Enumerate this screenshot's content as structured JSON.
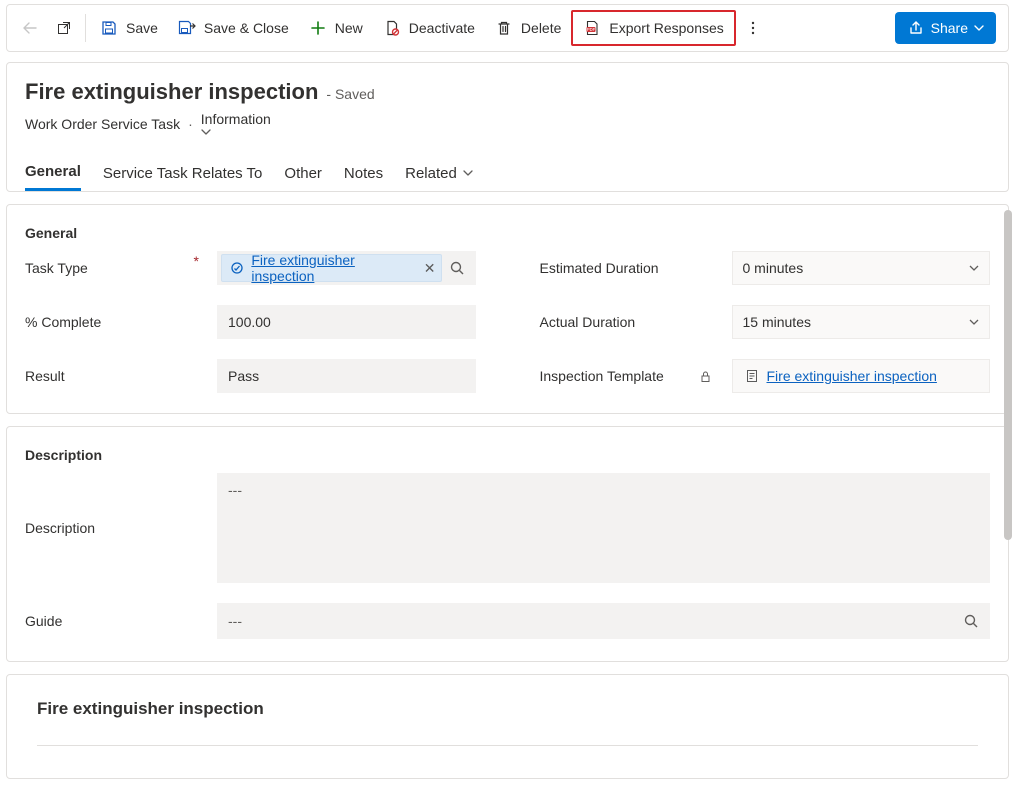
{
  "commandBar": {
    "save": "Save",
    "saveClose": "Save & Close",
    "newBtn": "New",
    "deactivate": "Deactivate",
    "deleteBtn": "Delete",
    "exportResponses": "Export Responses",
    "share": "Share"
  },
  "header": {
    "title": "Fire extinguisher inspection",
    "savedTag": "- Saved",
    "entity": "Work Order Service Task",
    "form": "Information"
  },
  "tabs": {
    "general": "General",
    "relates": "Service Task Relates To",
    "other": "Other",
    "notes": "Notes",
    "related": "Related"
  },
  "generalSection": {
    "heading": "General",
    "labels": {
      "taskType": "Task Type",
      "pctComplete": "% Complete",
      "result": "Result",
      "estDuration": "Estimated Duration",
      "actDuration": "Actual Duration",
      "inspTemplate": "Inspection Template"
    },
    "values": {
      "taskTypeLookup": "Fire extinguisher inspection",
      "pctComplete": "100.00",
      "result": "Pass",
      "estDuration": "0 minutes",
      "actDuration": "15 minutes",
      "inspTemplateLookup": "Fire extinguisher inspection"
    }
  },
  "descSection": {
    "heading": "Description",
    "labels": {
      "description": "Description",
      "guide": "Guide"
    },
    "values": {
      "description": "---",
      "guide": "---"
    }
  },
  "bottomCard": {
    "title": "Fire extinguisher inspection"
  }
}
